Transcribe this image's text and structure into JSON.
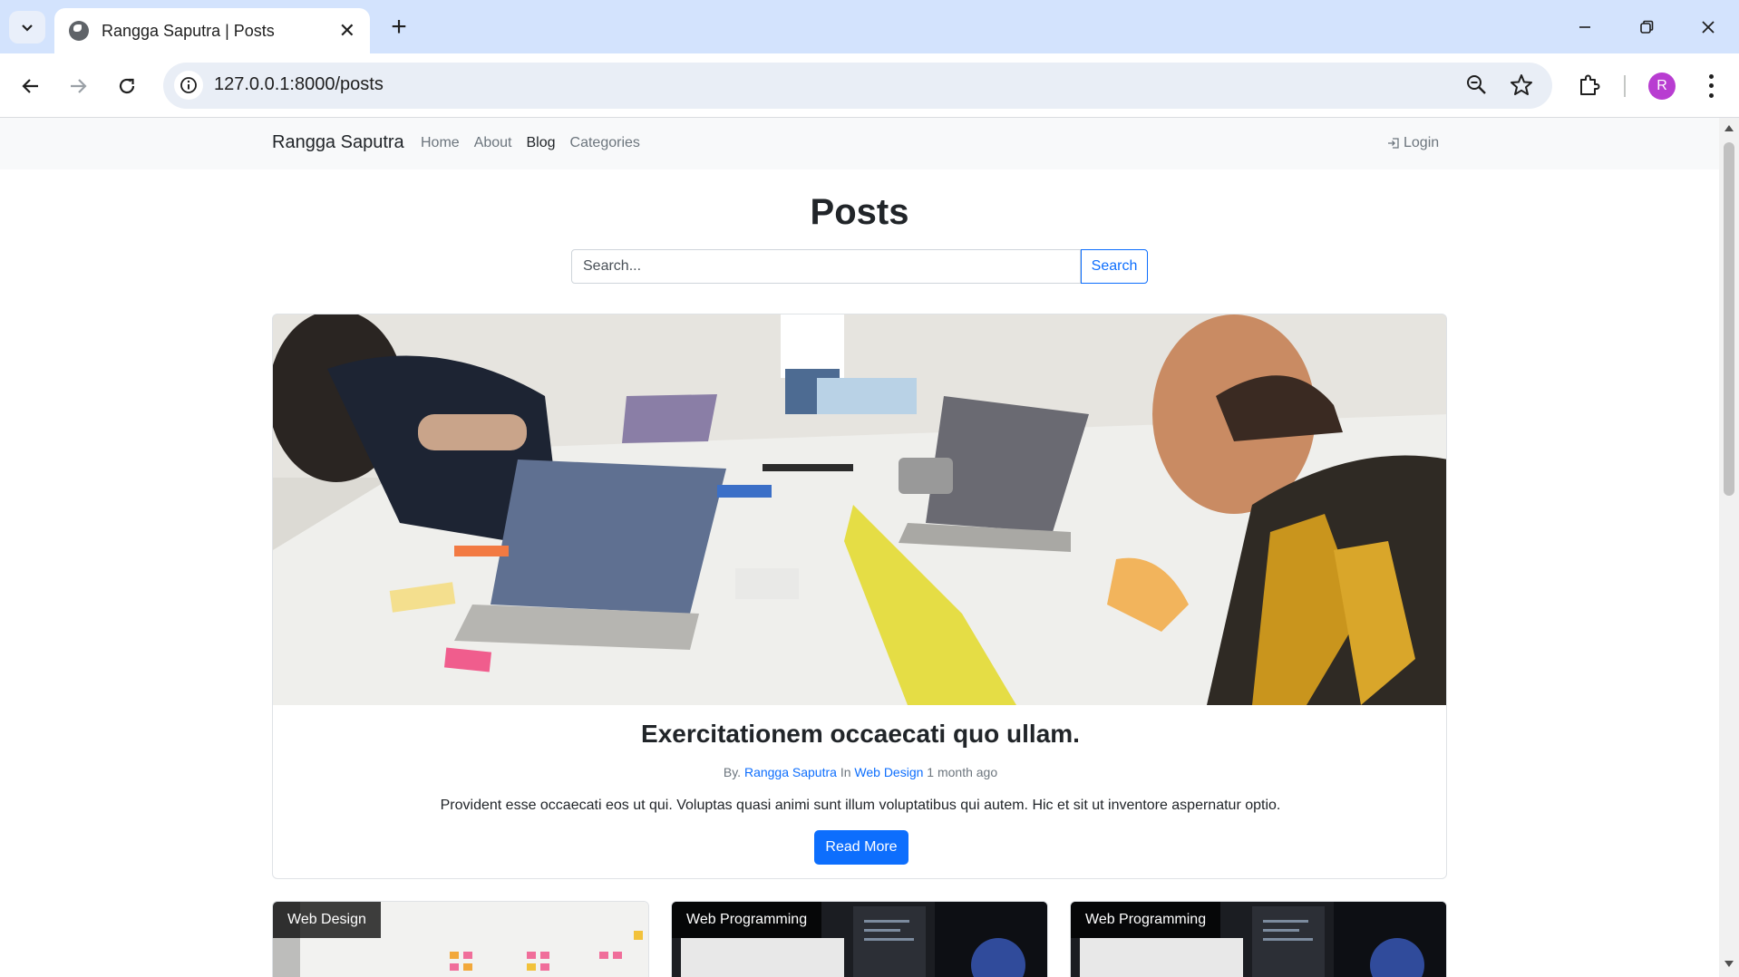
{
  "browser": {
    "tab_title": "Rangga Saputra | Posts",
    "url": "127.0.0.1:8000/posts",
    "profile_initial": "R"
  },
  "navbar": {
    "brand": "Rangga Saputra",
    "links": [
      "Home",
      "About",
      "Blog",
      "Categories"
    ],
    "active_link": "Blog",
    "login": "Login"
  },
  "page": {
    "title": "Posts",
    "search_placeholder": "Search...",
    "search_button": "Search"
  },
  "featured_post": {
    "title": "Exercitationem occaecati quo ullam.",
    "by_prefix": "By.",
    "author": "Rangga Saputra",
    "in_prefix": "In",
    "category": "Web Design",
    "time": "1 month ago",
    "excerpt": "Provident esse occaecati eos ut qui. Voluptas quasi animi sunt illum voluptatibus qui autem. Hic et sit ut inventore aspernatur optio.",
    "button": "Read More"
  },
  "post_cards": [
    {
      "category": "Web Design"
    },
    {
      "category": "Web Programming"
    },
    {
      "category": "Web Programming"
    }
  ],
  "colors": {
    "primary": "#0d6efd",
    "tabstrip": "#d3e3fd",
    "navbar_bg": "#f8f9fa",
    "avatar": "#b83dd1"
  }
}
